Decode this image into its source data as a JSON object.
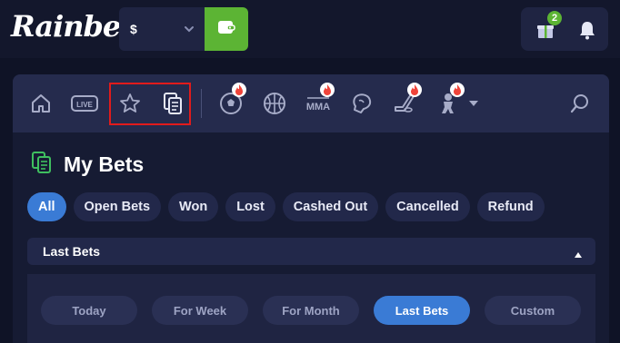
{
  "header": {
    "logo_text": "Rainbet",
    "currency_symbol": "$",
    "gift_count": "2",
    "icons": [
      "chevron-down-icon",
      "wallet-icon",
      "gift-icon",
      "bell-icon"
    ],
    "colors": {
      "wallet_green": "#5cb434",
      "badge_green": "#5cb434"
    }
  },
  "nav": {
    "items": [
      {
        "name": "home-icon"
      },
      {
        "name": "live-icon",
        "label": "LIVE"
      },
      {
        "name": "star-icon"
      },
      {
        "name": "my-bets-icon"
      },
      {
        "name": "soccer-icon",
        "hot": true
      },
      {
        "name": "basketball-icon",
        "hot": false
      },
      {
        "name": "mma-icon",
        "label": "MMA",
        "hot": true
      },
      {
        "name": "boxing-icon",
        "hot": false
      },
      {
        "name": "hockey-icon",
        "hot": true
      },
      {
        "name": "football-icon",
        "hot": true
      },
      {
        "name": "more-chevron-icon"
      },
      {
        "name": "search-icon"
      }
    ],
    "highlight_color": "#e21b1b"
  },
  "main": {
    "title": "My Bets",
    "filters": [
      "All",
      "Open Bets",
      "Won",
      "Lost",
      "Cashed Out",
      "Cancelled",
      "Refund"
    ],
    "active_filter": "All",
    "section_label": "Last Bets",
    "ranges": [
      "Today",
      "For Week",
      "For Month",
      "Last Bets",
      "Custom"
    ],
    "active_range": "Last Bets",
    "colors": {
      "accent": "#3a7bd5",
      "title_icon": "#3fbf5f"
    }
  }
}
